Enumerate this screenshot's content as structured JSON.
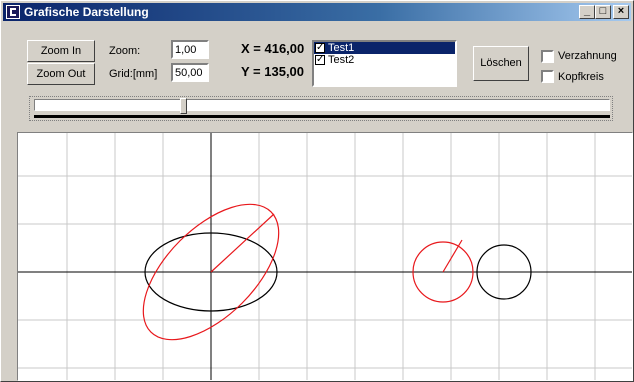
{
  "window": {
    "title": "Grafische Darstellung",
    "icon": "app-icon"
  },
  "titlebar_buttons": {
    "minimize": "_",
    "maximize": "□",
    "close": "×"
  },
  "toolbar": {
    "zoom_in": "Zoom In",
    "zoom_out": "Zoom Out",
    "zoom_label": "Zoom:",
    "zoom_value": "1,00",
    "grid_label": "Grid:[mm]",
    "grid_value": "50,00",
    "x_readout": "X = 416,00",
    "y_readout": "Y = 135,00",
    "delete_button": "Löschen",
    "option_gearing": "Verzahnung",
    "option_tip_circle": "Kopfkreis",
    "option_gearing_checked": false,
    "option_tip_circle_checked": false
  },
  "layers": [
    {
      "label": "Test1",
      "checked": true,
      "selected": true
    },
    {
      "label": "Test2",
      "checked": true,
      "selected": false
    }
  ],
  "slider": {
    "value_fraction": 0.22
  },
  "colors": {
    "black_shapes": "#000000",
    "red_shapes": "#e8181c",
    "grid": "#c8c8c8",
    "selection": "#0a246a"
  }
}
